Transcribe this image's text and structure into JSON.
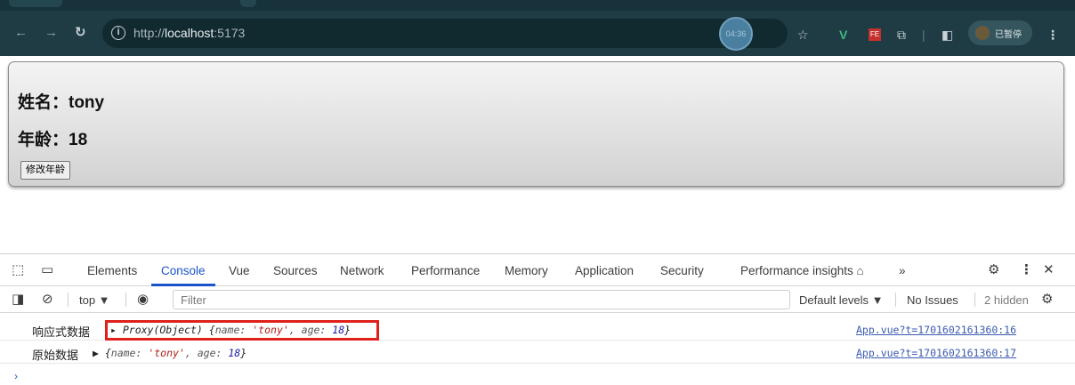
{
  "browser": {
    "url_prefix": "http://",
    "url_host": "localhost",
    "url_port": ":5173",
    "time_badge": "04:36",
    "profile_label": "已暂停",
    "ext_labels": {
      "v": "V",
      "fe": "FE"
    }
  },
  "page": {
    "name_line": "姓名：tony",
    "age_line": "年龄：18",
    "button_label": "修改年龄"
  },
  "devtools": {
    "tabs": [
      "Elements",
      "Console",
      "Vue",
      "Sources",
      "Network",
      "Performance",
      "Memory",
      "Application",
      "Security",
      "Performance insights ⌂"
    ],
    "more": "»",
    "active_tab": "Console",
    "context": "top ▼",
    "filter_placeholder": "Filter",
    "default_levels": "Default levels ▼",
    "no_issues": "No Issues",
    "hidden": "2 hidden",
    "logs": [
      {
        "label": "响应式数据",
        "prefix": "▸ Proxy(Object) {",
        "key1": "name: ",
        "val1": "'tony'",
        "key2": ", age: ",
        "val2": "18",
        "suffix": "}",
        "source": "App.vue?t=1701602161360:16"
      },
      {
        "label": "原始数据",
        "prefix": "▶ {",
        "key1": "name: ",
        "val1": "'tony'",
        "key2": ", age: ",
        "val2": "18",
        "suffix": "}",
        "source": "App.vue?t=1701602161360:17"
      }
    ],
    "prompt": "›"
  },
  "colors": {
    "toolbar_bg": "#1f3c44",
    "devtools_accent": "#1a55c8",
    "highlight": "#e0201a"
  }
}
